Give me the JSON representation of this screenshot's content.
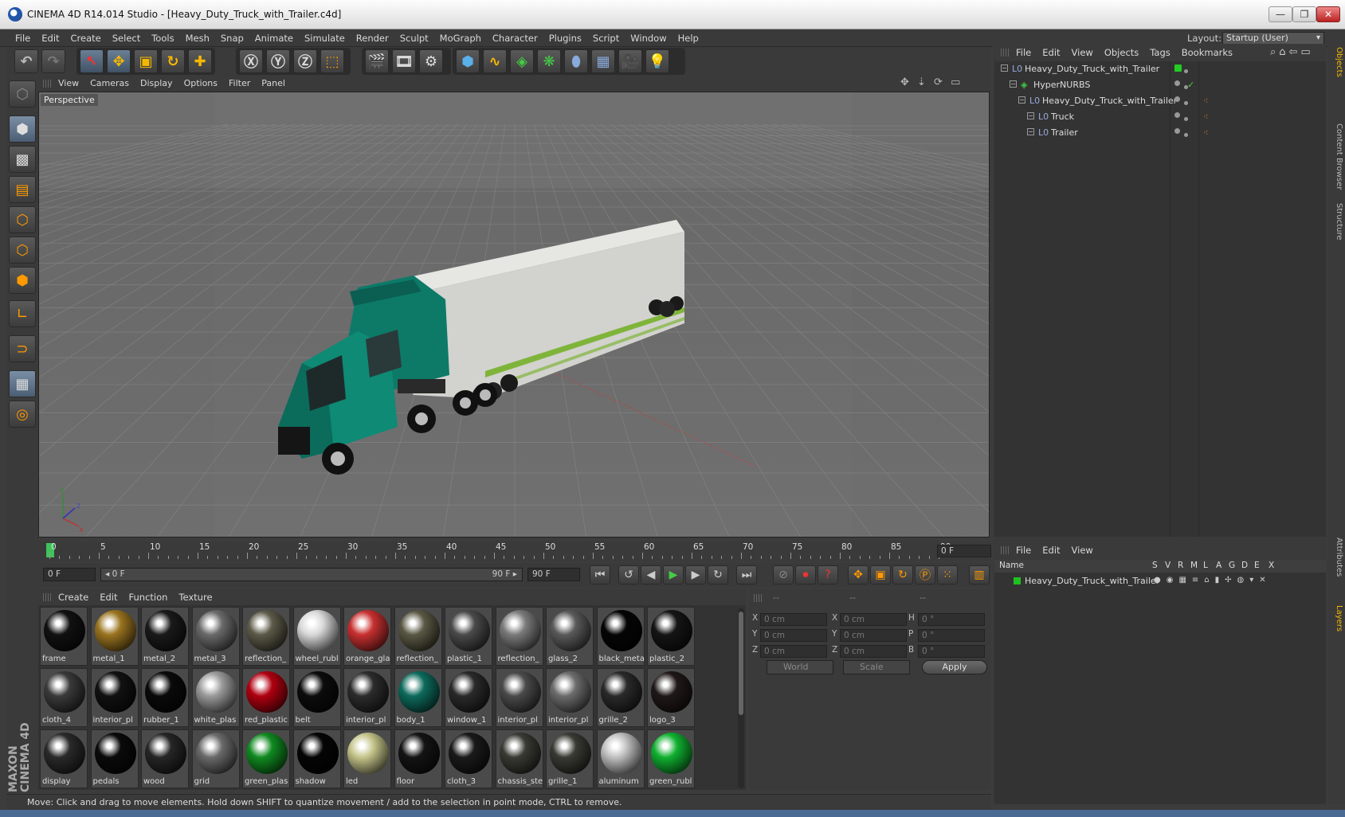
{
  "titlebar": {
    "title": "CINEMA 4D R14.014 Studio - [Heavy_Duty_Truck_with_Trailer.c4d]",
    "minimize": "—",
    "restore": "❐",
    "close": "✕"
  },
  "menubar": {
    "items": [
      "File",
      "Edit",
      "Create",
      "Select",
      "Tools",
      "Mesh",
      "Snap",
      "Animate",
      "Simulate",
      "Render",
      "Sculpt",
      "MoGraph",
      "Character",
      "Plugins",
      "Script",
      "Window",
      "Help"
    ]
  },
  "layout": {
    "label": "Layout:",
    "value": "Startup (User)"
  },
  "viewport": {
    "menu": [
      "View",
      "Cameras",
      "Display",
      "Options",
      "Filter",
      "Panel"
    ],
    "label": "Perspective",
    "nav_icons": "✥ ⇣ ⟳ ▭",
    "axis": {
      "y": "y",
      "z": "z",
      "x": "x"
    }
  },
  "timeline": {
    "ticks": [
      "0",
      "5",
      "10",
      "15",
      "20",
      "25",
      "30",
      "35",
      "40",
      "45",
      "50",
      "55",
      "60",
      "65",
      "70",
      "75",
      "80",
      "85",
      "90"
    ],
    "current_frame": "0 F"
  },
  "transport": {
    "start": "0 F",
    "range_start": "◂ 0 F",
    "range_end": "90 F ▸",
    "end": "90 F"
  },
  "materials": {
    "menu": [
      "Create",
      "Edit",
      "Function",
      "Texture"
    ],
    "items": [
      {
        "name": "frame",
        "color": "#111111"
      },
      {
        "name": "metal_1",
        "color": "#9a7420"
      },
      {
        "name": "metal_2",
        "color": "#1a1a1a"
      },
      {
        "name": "metal_3",
        "color": "#6a6a6a"
      },
      {
        "name": "reflection_",
        "color": "#5c5a48"
      },
      {
        "name": "wheel_rubl",
        "color": "#d8d8d8"
      },
      {
        "name": "orange_gla",
        "color": "#c83030"
      },
      {
        "name": "reflection_",
        "color": "#5a5844"
      },
      {
        "name": "plastic_1",
        "color": "#4a4a4a"
      },
      {
        "name": "reflection_",
        "color": "#7a7a7a"
      },
      {
        "name": "glass_2",
        "color": "#5a5a5a"
      },
      {
        "name": "black_meta",
        "color": "#050505"
      },
      {
        "name": "plastic_2",
        "color": "#151515"
      },
      {
        "name": "cloth_4",
        "color": "#3a3a3a"
      },
      {
        "name": "interior_pl",
        "color": "#111111"
      },
      {
        "name": "rubber_1",
        "color": "#0a0a0a"
      },
      {
        "name": "white_plas",
        "color": "#9a9a9a"
      },
      {
        "name": "red_plastic",
        "color": "#b00010"
      },
      {
        "name": "belt",
        "color": "#0c0c0c"
      },
      {
        "name": "interior_pl",
        "color": "#2c2c2c"
      },
      {
        "name": "body_1",
        "color": "#0d6a5c"
      },
      {
        "name": "window_1",
        "color": "#2a2a2a"
      },
      {
        "name": "interior_pl",
        "color": "#4a4a4a"
      },
      {
        "name": "interior_pl",
        "color": "#6c6c6c"
      },
      {
        "name": "grille_2",
        "color": "#2a2a2a"
      },
      {
        "name": "logo_3",
        "color": "#201818"
      },
      {
        "name": "display",
        "color": "#2a2a2a"
      },
      {
        "name": "pedals",
        "color": "#0a0a0a"
      },
      {
        "name": "wood",
        "color": "#262626"
      },
      {
        "name": "grid",
        "color": "#6a6a6a"
      },
      {
        "name": "green_plas",
        "color": "#108a20"
      },
      {
        "name": "shadow",
        "color": "#050505"
      },
      {
        "name": "led",
        "color": "#c4c48a"
      },
      {
        "name": "floor",
        "color": "#141414"
      },
      {
        "name": "cloth_3",
        "color": "#1a1a1a"
      },
      {
        "name": "chassis_ste",
        "color": "#3a3a34"
      },
      {
        "name": "grille_1",
        "color": "#3a3a34"
      },
      {
        "name": "aluminum",
        "color": "#c0c0c0"
      },
      {
        "name": "green_rubl",
        "color": "#10b030"
      }
    ]
  },
  "coords": {
    "headers": [
      "--",
      "--",
      "--"
    ],
    "rows": [
      {
        "a": "X",
        "av": "0 cm",
        "b": "X",
        "bv": "0 cm",
        "c": "H",
        "cv": "0 °"
      },
      {
        "a": "Y",
        "av": "0 cm",
        "b": "Y",
        "bv": "0 cm",
        "c": "P",
        "cv": "0 °"
      },
      {
        "a": "Z",
        "av": "0 cm",
        "b": "Z",
        "bv": "0 cm",
        "c": "B",
        "cv": "0 °"
      }
    ],
    "mode1": "World",
    "mode2": "Scale",
    "apply": "Apply"
  },
  "status": "Move: Click and drag to move elements. Hold down SHIFT to quantize movement / add to the selection in point mode, CTRL to remove.",
  "objects": {
    "menu": [
      "File",
      "Edit",
      "View",
      "Objects",
      "Tags",
      "Bookmarks"
    ],
    "tree": [
      {
        "name": "Heavy_Duty_Truck_with_Trailer",
        "indent": 0
      },
      {
        "name": "HyperNURBS",
        "indent": 1
      },
      {
        "name": "Heavy_Duty_Truck_with_Trailer",
        "indent": 2
      },
      {
        "name": "Truck",
        "indent": 3
      },
      {
        "name": "Trailer",
        "indent": 3
      }
    ]
  },
  "layers": {
    "menu": [
      "File",
      "Edit",
      "View"
    ],
    "columns": [
      "Name",
      "S",
      "V",
      "R",
      "M",
      "L",
      "A",
      "G",
      "D",
      "E",
      "X"
    ],
    "rows": [
      {
        "name": "Heavy_Duty_Truck_with_Trailer",
        "color": "#20c020"
      }
    ]
  },
  "sidetabs": [
    "Objects",
    "Content Browser",
    "Structure",
    "Attributes",
    "Layers"
  ],
  "maxon": "MAXON CINEMA 4D",
  "colors": {
    "truck": "#0d7a68",
    "trailer": "#d6d6d2",
    "accent": "#7fb43a"
  }
}
